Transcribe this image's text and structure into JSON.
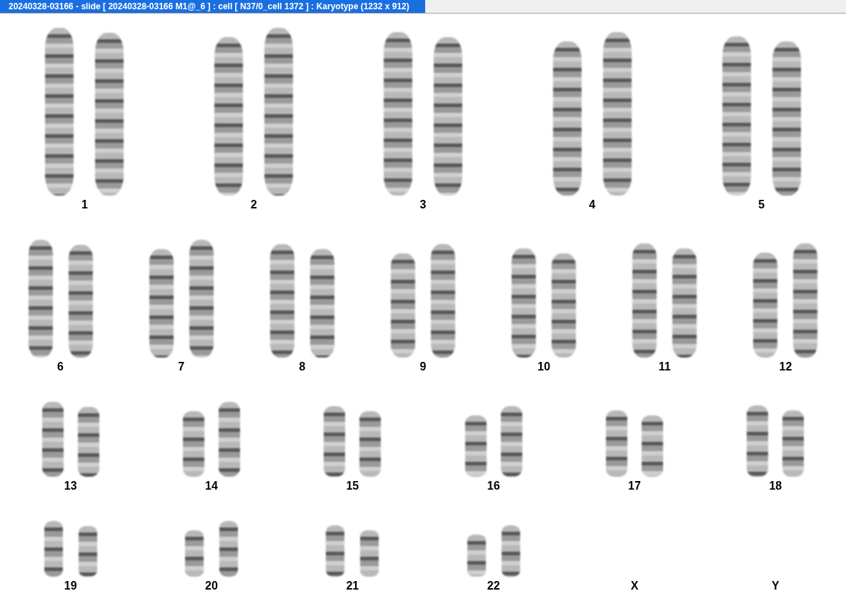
{
  "window": {
    "title": "20240328-03166 - slide [ 20240328-03166 M1@_6 ] : cell [ N37/0_cell 1372 ] : Karyotype  (1232 x 912)"
  },
  "karyotype_rows": [
    {
      "items": [
        {
          "label": "1",
          "present": true
        },
        {
          "label": "2",
          "present": true
        },
        {
          "label": "3",
          "present": true
        },
        {
          "label": "4",
          "present": true
        },
        {
          "label": "5",
          "present": true
        }
      ]
    },
    {
      "items": [
        {
          "label": "6",
          "present": true
        },
        {
          "label": "7",
          "present": true
        },
        {
          "label": "8",
          "present": true
        },
        {
          "label": "9",
          "present": true
        },
        {
          "label": "10",
          "present": true
        },
        {
          "label": "11",
          "present": true
        },
        {
          "label": "12",
          "present": true
        }
      ]
    },
    {
      "items": [
        {
          "label": "13",
          "present": true
        },
        {
          "label": "14",
          "present": true
        },
        {
          "label": "15",
          "present": true
        },
        {
          "label": "16",
          "present": true
        },
        {
          "label": "17",
          "present": true
        },
        {
          "label": "18",
          "present": true
        }
      ]
    },
    {
      "items": [
        {
          "label": "19",
          "present": true
        },
        {
          "label": "20",
          "present": true
        },
        {
          "label": "21",
          "present": true
        },
        {
          "label": "22",
          "present": true
        },
        {
          "label": "X",
          "present": false
        },
        {
          "label": "Y",
          "present": false
        }
      ]
    }
  ]
}
